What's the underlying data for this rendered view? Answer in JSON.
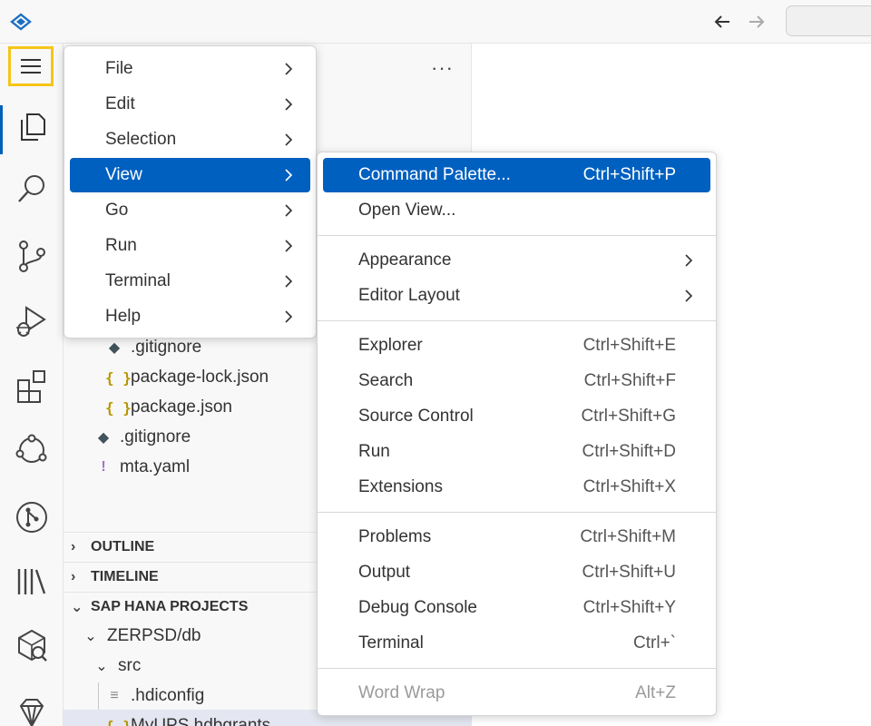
{
  "titlebar": {
    "logo": "sap-bas-logo-icon",
    "back": "arrow-left-icon",
    "forward": "arrow-right-icon"
  },
  "activity": [
    "menu-icon",
    "files-icon",
    "search-icon",
    "source-control-icon",
    "run-debug-icon",
    "extensions-icon",
    "cloud-icon",
    "git-graph-icon",
    "library-icon",
    "database-explorer-icon",
    "gem-icon"
  ],
  "sidebar": {
    "tree": [
      {
        "label": ".gitignore",
        "icon": "git-icon"
      },
      {
        "label": "package-lock.json",
        "icon": "json-icon"
      },
      {
        "label": "package.json",
        "icon": "json-icon"
      },
      {
        "label": ".gitignore",
        "icon": "git-icon"
      },
      {
        "label": "mta.yaml",
        "icon": "yaml-icon"
      }
    ],
    "sections": [
      {
        "label": "OUTLINE"
      },
      {
        "label": "TIMELINE"
      },
      {
        "label": "SAP HANA PROJECTS"
      }
    ],
    "hana": [
      {
        "label": "ZERPSD/db"
      },
      {
        "label": "src"
      },
      {
        "label": ".hdiconfig"
      },
      {
        "label": "MyUPS.hdbgrants"
      }
    ]
  },
  "main_menu": [
    {
      "label": "File"
    },
    {
      "label": "Edit"
    },
    {
      "label": "Selection"
    },
    {
      "label": "View"
    },
    {
      "label": "Go"
    },
    {
      "label": "Run"
    },
    {
      "label": "Terminal"
    },
    {
      "label": "Help"
    }
  ],
  "view_menu": [
    {
      "label": "Command Palette...",
      "key": "Ctrl+Shift+P"
    },
    {
      "label": "Open View...",
      "key": ""
    },
    {
      "label": "Appearance",
      "key": ""
    },
    {
      "label": "Editor Layout",
      "key": ""
    },
    {
      "label": "Explorer",
      "key": "Ctrl+Shift+E"
    },
    {
      "label": "Search",
      "key": "Ctrl+Shift+F"
    },
    {
      "label": "Source Control",
      "key": "Ctrl+Shift+G"
    },
    {
      "label": "Run",
      "key": "Ctrl+Shift+D"
    },
    {
      "label": "Extensions",
      "key": "Ctrl+Shift+X"
    },
    {
      "label": "Problems",
      "key": "Ctrl+Shift+M"
    },
    {
      "label": "Output",
      "key": "Ctrl+Shift+U"
    },
    {
      "label": "Debug Console",
      "key": "Ctrl+Shift+Y"
    },
    {
      "label": "Terminal",
      "key": "Ctrl+`"
    },
    {
      "label": "Word Wrap",
      "key": "Alt+Z"
    }
  ],
  "colors": {
    "highlight": "#0060c0",
    "focus_ring": "#f5c518",
    "active_bar": "#005fb8"
  }
}
